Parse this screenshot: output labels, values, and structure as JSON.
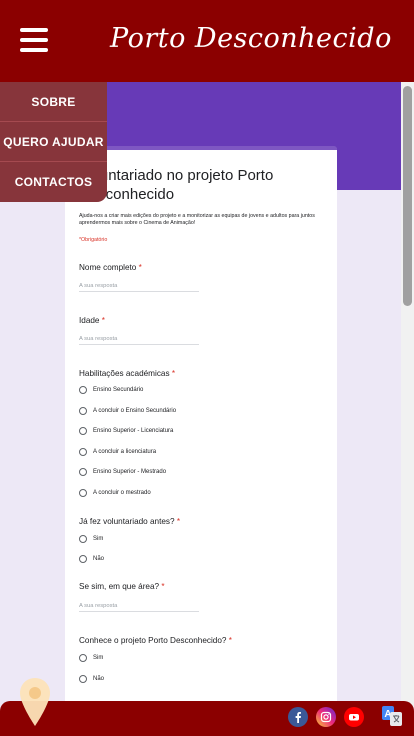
{
  "header": {
    "brand_title": "Porto Desconhecido",
    "menu_icon": "hamburger-menu-icon"
  },
  "menu": {
    "items": [
      {
        "label": "SOBRE"
      },
      {
        "label": "QUERO AJUDAR"
      },
      {
        "label": "CONTACTOS"
      }
    ]
  },
  "form": {
    "title": "Voluntariado no projeto Porto Desconhecido",
    "description": "Ajuda-nos a criar mais edições do projeto e a monitorizar as equipas de jovens e adultos para juntos aprendermos mais sobre o Cinema de Animação!",
    "required_note": "*Obrigatório",
    "required_mark": "*",
    "answer_placeholder": "A sua resposta",
    "questions": [
      {
        "label": "Nome completo"
      },
      {
        "label": "Idade"
      },
      {
        "label": "Habilitações académicas",
        "options": [
          "Ensino Secundário",
          "A concluir o Ensino Secundário",
          "Ensino Superior - Licenciatura",
          "A concluir a licenciatura",
          "Ensino Superior - Mestrado",
          "A concluir o mestrado"
        ]
      },
      {
        "label": "Já fez voluntariado antes?",
        "options": [
          "Sim",
          "Não"
        ]
      },
      {
        "label": "Se sim, em que área?"
      },
      {
        "label": "Conhece o projeto Porto Desconhecido?",
        "options": [
          "Sim",
          "Não"
        ]
      }
    ]
  },
  "footer": {
    "icons": [
      "location-pin-icon",
      "facebook-icon",
      "instagram-icon",
      "youtube-icon",
      "translate-icon"
    ]
  },
  "colors": {
    "brand_red": "#8b0000",
    "menu_bg": "#87353b",
    "form_purple": "#673ab7",
    "required_red": "#d93025"
  }
}
